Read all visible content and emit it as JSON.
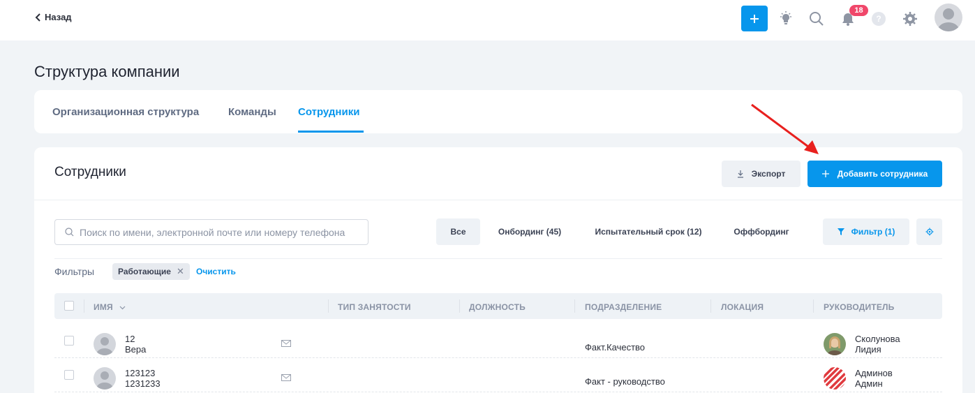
{
  "header": {
    "back_label": "Назад",
    "notification_count": "18",
    "help_label": "?"
  },
  "page": {
    "title": "Структура компании"
  },
  "tabs": [
    {
      "label": "Организационная структура"
    },
    {
      "label": "Команды"
    },
    {
      "label": "Сотрудники"
    }
  ],
  "card": {
    "title": "Сотрудники",
    "export_label": "Экспорт",
    "add_label": "Добавить сотрудника"
  },
  "search": {
    "placeholder": "Поиск по имени, электронной почте или номеру телефона"
  },
  "segments": [
    {
      "label": "Все"
    },
    {
      "label": "Онбординг (45)"
    },
    {
      "label": "Испытательный срок (12)"
    },
    {
      "label": "Оффбординг"
    }
  ],
  "filter_button": "Фильтр (1)",
  "filters": {
    "label": "Фильтры",
    "chips": [
      {
        "label": "Работающие"
      }
    ],
    "clear_label": "Очистить"
  },
  "table": {
    "columns": [
      "ИМЯ",
      "ТИП ЗАНЯТОСТИ",
      "ДОЛЖНОСТЬ",
      "ПОДРАЗДЕЛЕНИЕ",
      "ЛОКАЦИЯ",
      "РУКОВОДИТЕЛЬ"
    ],
    "rows": [
      {
        "name_line1": "12",
        "name_line2": "Вера",
        "department": "Факт.Качество",
        "manager_line1": "Сколунова",
        "manager_line2": "Лидия"
      },
      {
        "name_line1": "123123",
        "name_line2": "1231233",
        "department": "Факт - руководство",
        "manager_line1": "Админов",
        "manager_line2": "Админ"
      }
    ]
  },
  "colors": {
    "accent": "#0796ec",
    "badge": "#f0476a",
    "arrow": "#e8201e"
  }
}
